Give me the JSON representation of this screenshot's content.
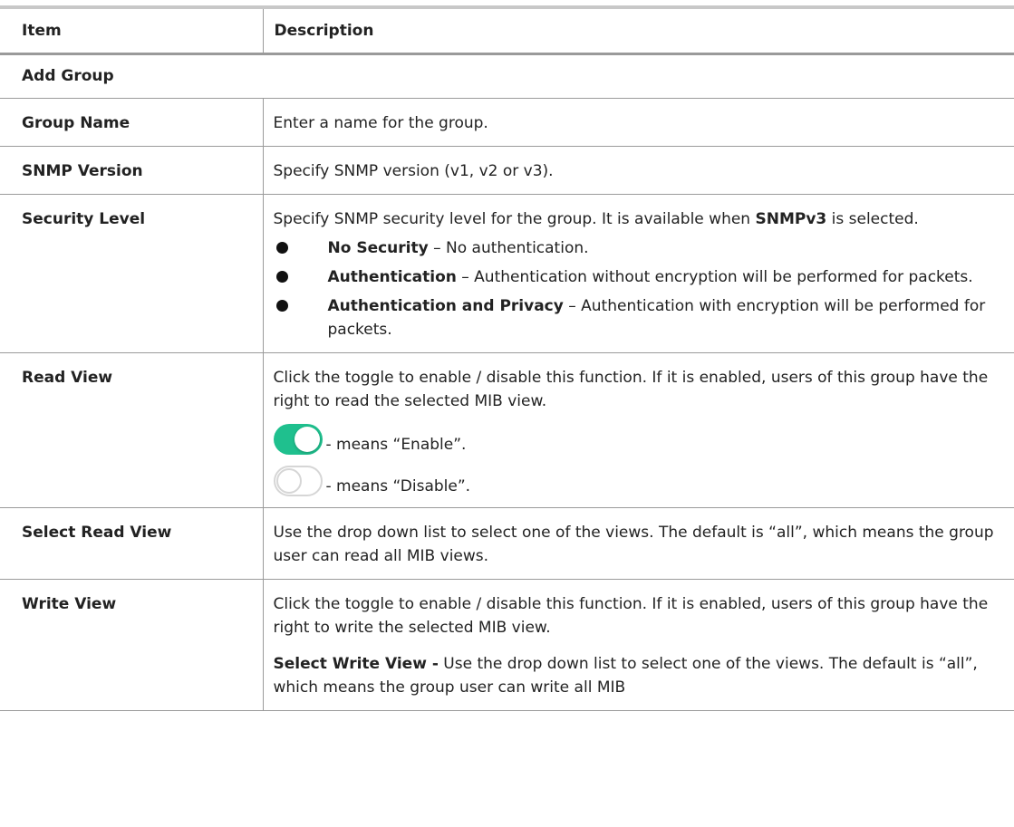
{
  "header": {
    "item": "Item",
    "description": "Description"
  },
  "section": {
    "label": "Add Group"
  },
  "rows": {
    "group_name": {
      "key": "Group Name",
      "desc": "Enter a name for the group."
    },
    "snmp_version": {
      "key": "SNMP Version",
      "desc": "Specify SNMP version (v1, v2 or v3)."
    },
    "security_level": {
      "key": "Security Level",
      "desc_pre": "Specify SNMP security level for the group. It is available when ",
      "desc_bold": "SNMPv3",
      "desc_post": " is selected.",
      "bullets": [
        {
          "term": "No Security",
          "text": " – No authentication."
        },
        {
          "term": "Authentication",
          "text": " – Authentication without encryption will be performed for packets."
        },
        {
          "term": "Authentication and Privacy",
          "text": " – Authentication with encryption will be performed for packets."
        }
      ]
    },
    "read_view": {
      "key": "Read View",
      "desc": "Click the toggle to enable / disable this function. If it is enabled, users of this group have the right to read the selected MIB view.",
      "enable_text": "- means “Enable”.",
      "disable_text": "- means “Disable”."
    },
    "select_read_view": {
      "key": "Select Read View",
      "desc": "Use the drop down list to select one of the views. The default is “all”, which means the group user can read all MIB views."
    },
    "write_view": {
      "key": "Write View",
      "desc": "Click the toggle to enable / disable this function. If it is enabled, users of this group have the right to write the selected MIB view.",
      "sub_bold": "Select Write View -",
      "sub_text": " Use the drop down list to select one of the views. The default is “all”, which means the group user can write all MIB"
    }
  },
  "colors": {
    "toggle_on": "#1fc08e",
    "toggle_off_border": "#d6d6d6",
    "rule": "#9a9a9a"
  }
}
